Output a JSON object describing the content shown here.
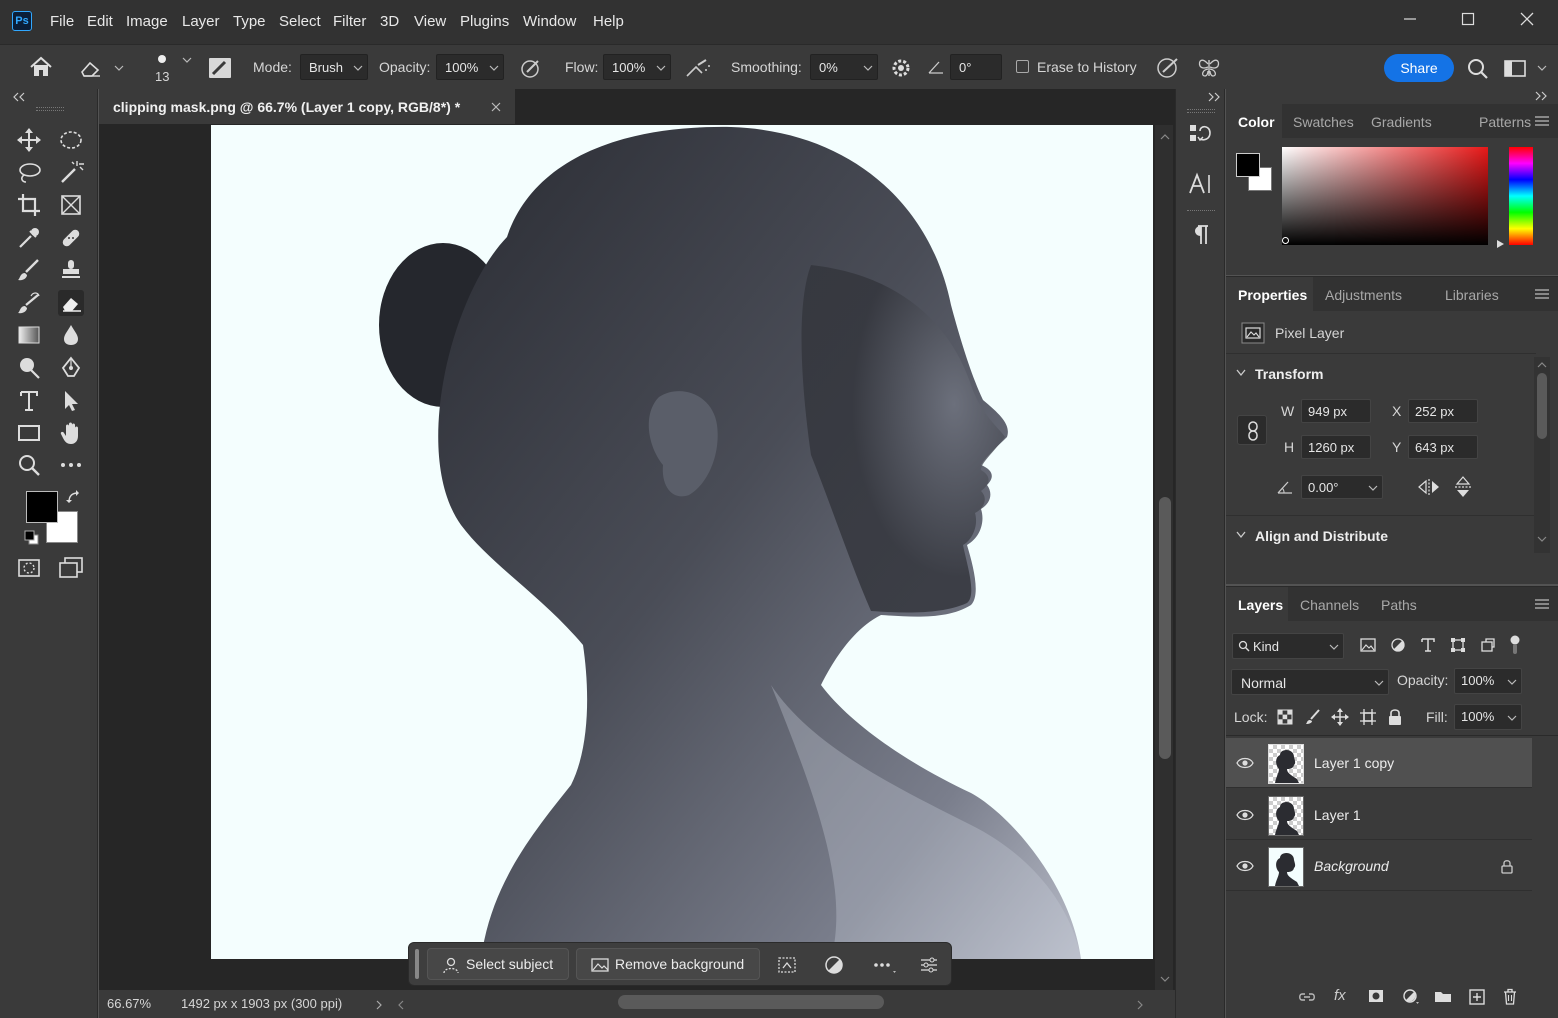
{
  "menubar": {
    "logo": "Ps",
    "items": [
      "File",
      "Edit",
      "Image",
      "Layer",
      "Type",
      "Select",
      "Filter",
      "3D",
      "View",
      "Plugins",
      "Window",
      "Help"
    ]
  },
  "options": {
    "brush_size": "13",
    "mode_label": "Mode:",
    "mode_value": "Brush",
    "opacity_label": "Opacity:",
    "opacity_value": "100%",
    "flow_label": "Flow:",
    "flow_value": "100%",
    "smoothing_label": "Smoothing:",
    "smoothing_value": "0%",
    "angle_value": "0°",
    "erase_history_label": "Erase to History",
    "share_label": "Share"
  },
  "document": {
    "tab_title": "clipping mask.png @ 66.7% (Layer 1 copy, RGB/8*) *",
    "zoom": "66.67%",
    "doc_info": "1492 px x 1903 px (300 ppi)"
  },
  "taskbar": {
    "select_subject": "Select subject",
    "remove_background": "Remove background"
  },
  "color_panel": {
    "tabs": [
      "Color",
      "Swatches",
      "Gradients",
      "Patterns"
    ],
    "foreground": "#000000",
    "background": "#ffffff"
  },
  "properties_panel": {
    "tabs": [
      "Properties",
      "Adjustments",
      "Libraries"
    ],
    "layer_type": "Pixel Layer",
    "transform_title": "Transform",
    "w_label": "W",
    "w_value": "949 px",
    "h_label": "H",
    "h_value": "1260 px",
    "x_label": "X",
    "x_value": "252 px",
    "y_label": "Y",
    "y_value": "643 px",
    "angle_value": "0.00°",
    "align_title": "Align and Distribute"
  },
  "layers_panel": {
    "tabs": [
      "Layers",
      "Channels",
      "Paths"
    ],
    "kind_label": "Kind",
    "blend_mode": "Normal",
    "opacity_label": "Opacity:",
    "opacity_value": "100%",
    "lock_label": "Lock:",
    "fill_label": "Fill:",
    "fill_value": "100%",
    "layers": [
      {
        "name": "Layer 1 copy",
        "selected": true
      },
      {
        "name": "Layer 1",
        "selected": false
      },
      {
        "name": "Background",
        "selected": false,
        "locked": true
      }
    ]
  },
  "accent_color": "#1473e6"
}
